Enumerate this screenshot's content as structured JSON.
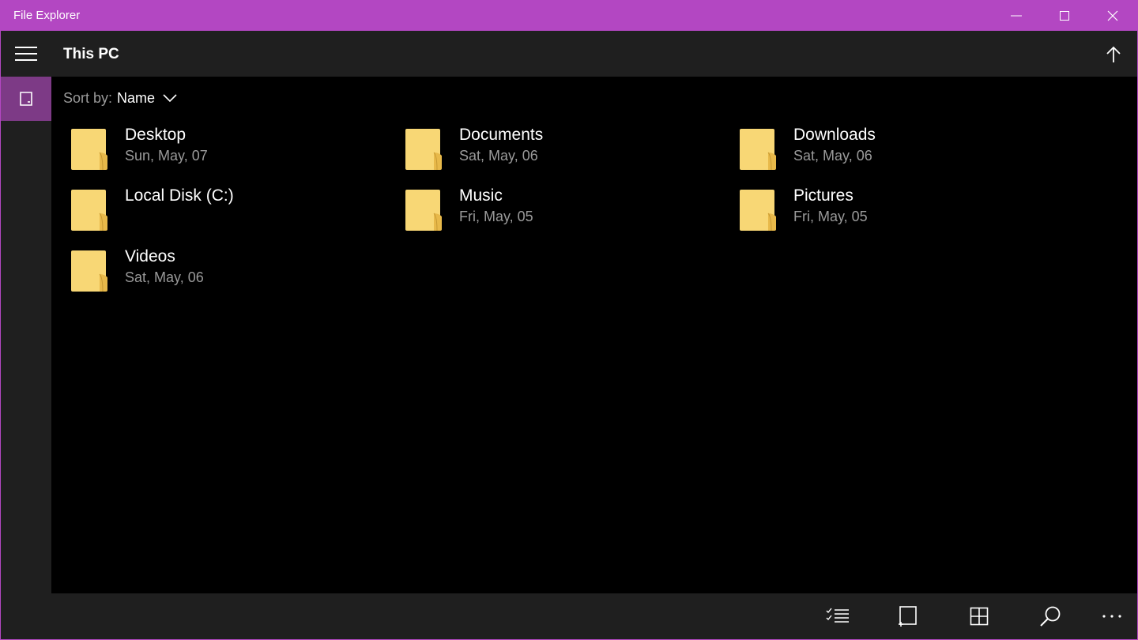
{
  "window": {
    "title": "File Explorer",
    "accent": "#b347c2",
    "controls": [
      "minimize-icon",
      "maximize-icon",
      "close-icon"
    ]
  },
  "nav": {
    "menu_icon": "hamburger-icon",
    "selected_item_icon": "device-icon",
    "selected_color": "#7d3a86"
  },
  "header": {
    "title": "This PC",
    "up_icon": "arrow-up-icon"
  },
  "sort": {
    "label": "Sort by:",
    "value": "Name"
  },
  "items": [
    {
      "name": "Desktop",
      "date": "Sun, May, 07"
    },
    {
      "name": "Documents",
      "date": "Sat, May, 06"
    },
    {
      "name": "Downloads",
      "date": "Sat, May, 06"
    },
    {
      "name": "Local Disk (C:)",
      "date": ""
    },
    {
      "name": "Music",
      "date": "Fri, May, 05"
    },
    {
      "name": "Pictures",
      "date": "Fri, May, 05"
    },
    {
      "name": "Videos",
      "date": "Sat, May, 06"
    }
  ],
  "commandbar": {
    "icons": [
      "select-list-icon",
      "new-tab-icon",
      "grid-view-icon",
      "search-icon",
      "more-icon"
    ]
  },
  "colors": {
    "folder": "#f8d775",
    "folder_shade": "#e8b94a",
    "secondary_text": "#9a9a9a",
    "chrome": "#1f1f1f"
  }
}
